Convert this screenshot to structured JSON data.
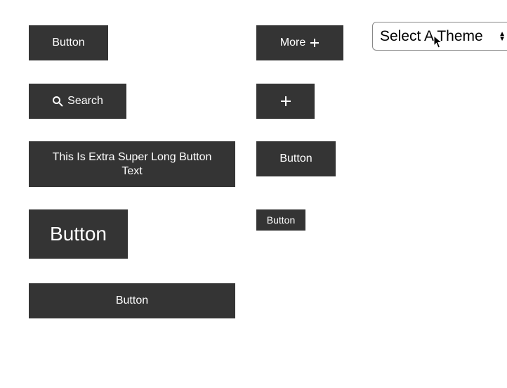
{
  "theme_select": {
    "selected": "Select A Theme"
  },
  "buttons": {
    "basic": "Button",
    "more": "More",
    "search": "Search",
    "long": "This Is Extra Super Long Button Text",
    "right3": "Button",
    "big": "Button",
    "small": "Button",
    "wide": "Button"
  }
}
